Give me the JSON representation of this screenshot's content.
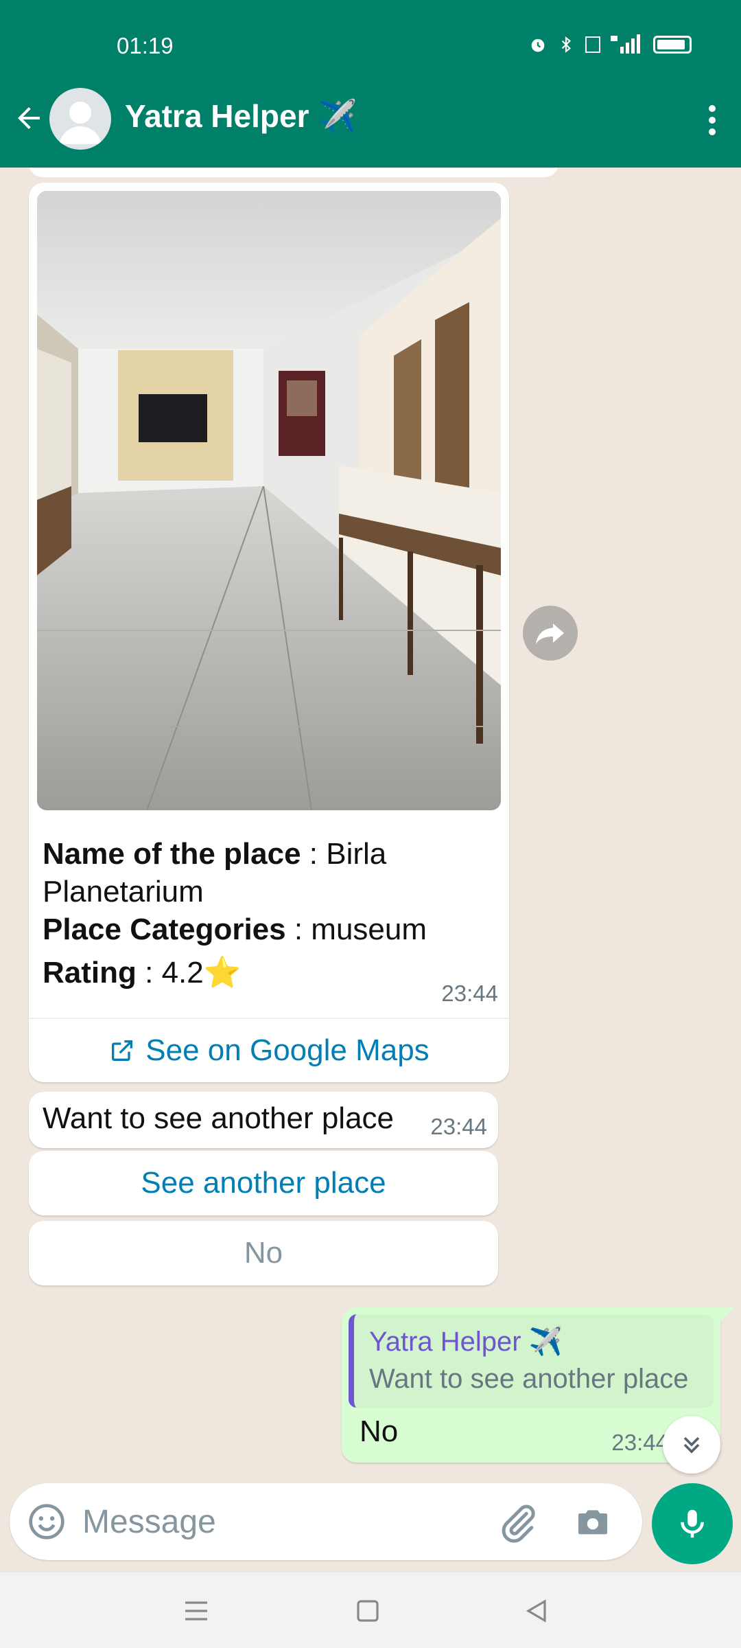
{
  "status_bar": {
    "time": "01:19",
    "icons": [
      "alarm-icon",
      "bluetooth-icon",
      "volte-icon",
      "4g-signal-icon",
      "battery-icon"
    ]
  },
  "header": {
    "title": "Yatra Helper ✈️",
    "back_icon": "back-arrow-icon",
    "menu_icon": "more-vert-icon"
  },
  "place_card": {
    "name_label": "Name of the place",
    "name_value": " : Birla Planetarium",
    "category_label": "Place Categories",
    "category_value": " : museum",
    "rating_label": "Rating",
    "rating_value": "  : 4.2⭐",
    "time": "23:44",
    "maps_link_label": "See on Google Maps"
  },
  "prompt_message": {
    "text": "Want to see another place",
    "time": "23:44"
  },
  "quick_replies": [
    "See another place",
    "No"
  ],
  "reply_message": {
    "quoted_sender": "Yatra Helper ✈️",
    "quoted_text": "Want to see another place",
    "text": "No",
    "time": "23:44"
  },
  "composer": {
    "placeholder": "Message"
  },
  "colors": {
    "header": "#008069",
    "chat_background": "#efe7dd",
    "outgoing_bubble": "#d9fdd3",
    "link": "#027eb5",
    "mic_button": "#00a884",
    "quote_accent": "#6e56cf"
  }
}
